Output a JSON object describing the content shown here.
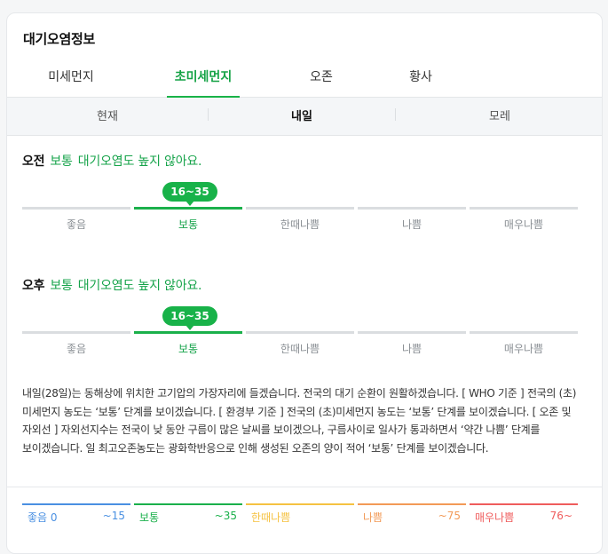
{
  "title": "대기오염정보",
  "tabs": [
    "미세먼지",
    "초미세먼지",
    "오존",
    "황사"
  ],
  "days": [
    "현재",
    "내일",
    "모레"
  ],
  "morning": {
    "label": "오전",
    "grade": "보통",
    "message": "대기오염도 높지 않아요.",
    "value_range": "16~35",
    "levels": [
      "좋음",
      "보통",
      "한때나쁨",
      "나쁨",
      "매우나쁨"
    ]
  },
  "afternoon": {
    "label": "오후",
    "grade": "보통",
    "message": "대기오염도 높지 않아요.",
    "value_range": "16~35",
    "levels": [
      "좋음",
      "보통",
      "한때나쁨",
      "나쁨",
      "매우나쁨"
    ]
  },
  "description": "내일(28일)는 동해상에 위치한 고기압의 가장자리에 들겠습니다. 전국의 대기 순환이 원활하겠습니다. [ WHO 기준 ] 전국의 (초)미세먼지 농도는 ‘보통’ 단계를 보이겠습니다. [ 환경부 기준 ] 전국의 (초)미세먼지 농도는 ‘보통’ 단계를 보이겠습니다. [ 오존 및 자외선 ] 자외선지수는 전국이 낮 동안 구름이 많은 날씨를 보이겠으나, 구름사이로 일사가 통과하면서 ‘약간 나쁨’ 단계를 보이겠습니다. 일 최고오존농도는 광화학반응으로 인해 생성된 오존의 양이 적어 ‘보통’ 단계를 보이겠습니다.",
  "legend": [
    {
      "name": "좋음 0",
      "range": "~15",
      "color": "#4a90e2"
    },
    {
      "name": "보통",
      "range": "~35",
      "color": "#1bb04b"
    },
    {
      "name": "한때나쁨",
      "range": "",
      "color": "#f5c242"
    },
    {
      "name": "나쁨",
      "range": "~75",
      "color": "#f29a57"
    },
    {
      "name": "매우나쁨",
      "range": "76~",
      "color": "#ef5c5c"
    }
  ],
  "colors": {
    "accent": "#19b347",
    "inactive_bar": "#dadde0"
  }
}
